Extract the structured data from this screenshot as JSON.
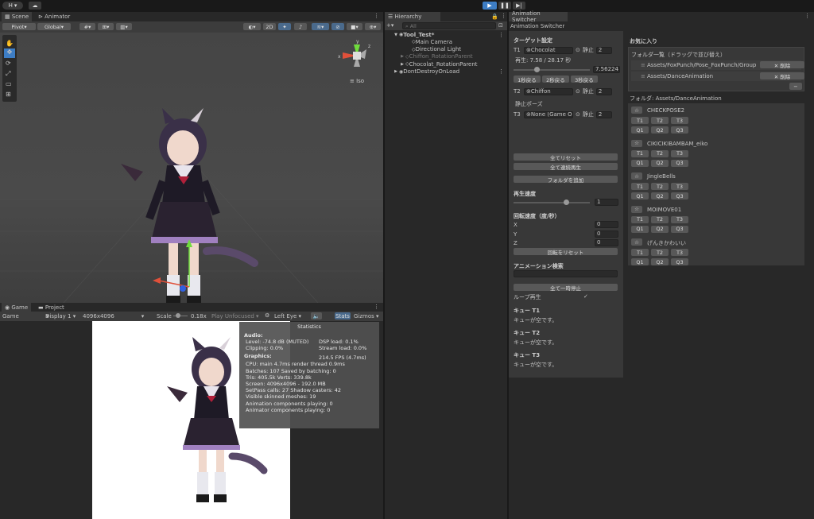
{
  "topbar": {
    "account": "H",
    "play_icon": "play-icon",
    "pause_icon": "pause-icon",
    "step_icon": "step-icon"
  },
  "scene": {
    "tabs": [
      "Scene",
      "Animator"
    ],
    "pivot": "Pivot",
    "global": "Global",
    "mode_2d": "2D",
    "iso": "Iso",
    "axes": {
      "x": "x",
      "y": "y",
      "z": "z"
    }
  },
  "game": {
    "tabs": [
      "Game",
      "Project"
    ],
    "view": "Game",
    "display": "Display 1",
    "resolution": "4096x4096",
    "scale_label": "Scale",
    "scale_value": "0.18x",
    "play_mode": "Play Unfocused",
    "eye": "Left Eye",
    "stats": "Stats",
    "gizmos": "Gizmos"
  },
  "stats": {
    "title": "Statistics",
    "audio_header": "Audio:",
    "level": "Level: -74.8 dB (MUTED)",
    "dsp": "DSP load: 0.1%",
    "clipping": "Clipping: 0.0%",
    "stream": "Stream load: 0.0%",
    "graphics_header": "Graphics:",
    "fps": "214.5 FPS (4.7ms)",
    "cpu": "CPU: main 4.7ms  render thread 0.9ms",
    "batches": "Batches: 107   Saved by batching: 0",
    "tris": "Tris: 405.5k     Verts: 339.8k",
    "screen": "Screen: 4096x4096 - 192.0 MB",
    "setpass": "SetPass calls: 27          Shadow casters: 42",
    "skinned": "Visible skinned meshes: 19",
    "anim_comp": "Animation components playing: 0",
    "animator_comp": "Animator components playing: 0"
  },
  "hierarchy": {
    "tab": "Hierarchy",
    "search_placeholder": "All",
    "items": [
      {
        "label": "Tool_Test*",
        "indent": 0,
        "bold": true,
        "dim": false,
        "arrow": "▼"
      },
      {
        "label": "Main Camera",
        "indent": 2,
        "bold": false,
        "dim": false,
        "arrow": ""
      },
      {
        "label": "Directional Light",
        "indent": 2,
        "bold": false,
        "dim": false,
        "arrow": ""
      },
      {
        "label": "Chiffon_RotationParent",
        "indent": 1,
        "bold": false,
        "dim": true,
        "arrow": "▶"
      },
      {
        "label": "Chocolat_RotationParent",
        "indent": 1,
        "bold": false,
        "dim": false,
        "arrow": "▶"
      },
      {
        "label": "DontDestroyOnLoad",
        "indent": 0,
        "bold": false,
        "dim": false,
        "arrow": "▶"
      }
    ]
  },
  "switcher": {
    "tab": "Animation Switcher",
    "title": "Animation Switcher",
    "target_header": "ターゲット設定",
    "t1": {
      "label": "T1",
      "obj": "Chocolat",
      "toggle": "静止",
      "num": "2"
    },
    "playback": "再生: 7.58 / 28.17 秒",
    "slider_value": "7.56224",
    "back1": "1秒戻る",
    "back2": "2秒戻る",
    "back3": "3秒戻る",
    "t2": {
      "label": "T2",
      "obj": "Chiffon",
      "toggle": "静止",
      "num": "2"
    },
    "static_pose": "静止ポーズ",
    "t3": {
      "label": "T3",
      "obj": "None (Game Obje",
      "toggle": "静止",
      "num": "2"
    },
    "reset_all": "全てリセット",
    "play_all": "全て連続再生",
    "add_folder": "フォルダを追加",
    "speed_header": "再生速度",
    "speed_value": "1",
    "rot_header": "回転速度（度/秒）",
    "x_label": "X",
    "x_val": "0",
    "y_label": "Y",
    "y_val": "0",
    "z_label": "Z",
    "z_val": "0",
    "reset_rot": "回転をリセット",
    "search_header": "アニメーション検索",
    "pause_all": "全て一時停止",
    "loop": "ループ再生",
    "loop_check": "✓",
    "q1": "キュー T1",
    "q1_empty": "キューが空です。",
    "q2": "キュー T2",
    "q2_empty": "キューが空です。",
    "q3": "キュー T3",
    "q3_empty": "キューが空です。"
  },
  "favorites": {
    "header": "お気に入り",
    "list_header": "フォルダ一覧（ドラッグで並び替え）",
    "remove_label": "✕ 削除",
    "minus": "−",
    "folders": [
      "Assets/FoxPunch/Pose_FoxPunch/Group",
      "Assets/DanceAnimation"
    ],
    "current_folder": "フォルダ: Assets/DanceAnimation",
    "star": "☆",
    "t_labels": [
      "T1",
      "T2",
      "T3"
    ],
    "q_labels": [
      "Q1",
      "Q2",
      "Q3"
    ],
    "anims": [
      "CHECKPOSE2",
      "CIKICIKIBAMBAM_eiko",
      "JingleBells",
      "MOIMOVE01",
      "げんきかわいい"
    ]
  },
  "colors": {
    "accent": "#3d7dc4",
    "panel": "#383838",
    "dark": "#282828"
  }
}
